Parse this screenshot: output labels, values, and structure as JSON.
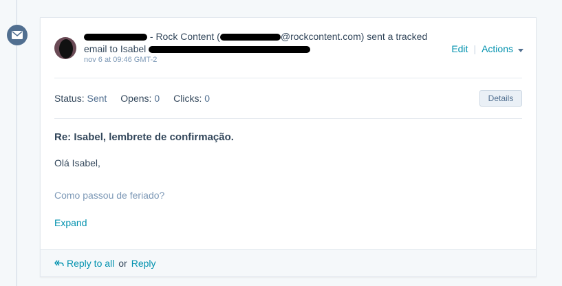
{
  "timeline": {
    "icon": "envelope-icon"
  },
  "email": {
    "sender_suffix": "- Rock Content (",
    "sender_email_domain": "@rockcontent.com",
    "action_text": ") sent a tracked",
    "action_text2": "email to Isabel",
    "timestamp": "nov 6 at 09:46 GMT-2",
    "edit_label": "Edit",
    "actions_label": "Actions"
  },
  "stats": {
    "status_label": "Status:",
    "status_value": "Sent",
    "opens_label": "Opens:",
    "opens_value": "0",
    "clicks_label": "Clicks:",
    "clicks_value": "0",
    "details_label": "Details"
  },
  "content": {
    "subject": "Re: Isabel, lembrete de confirmação.",
    "line1": "Olá Isabel,",
    "line2": "Como passou de feriado?",
    "expand_label": "Expand"
  },
  "footer": {
    "reply_all_label": "Reply to all",
    "or_label": "or",
    "reply_label": "Reply"
  }
}
